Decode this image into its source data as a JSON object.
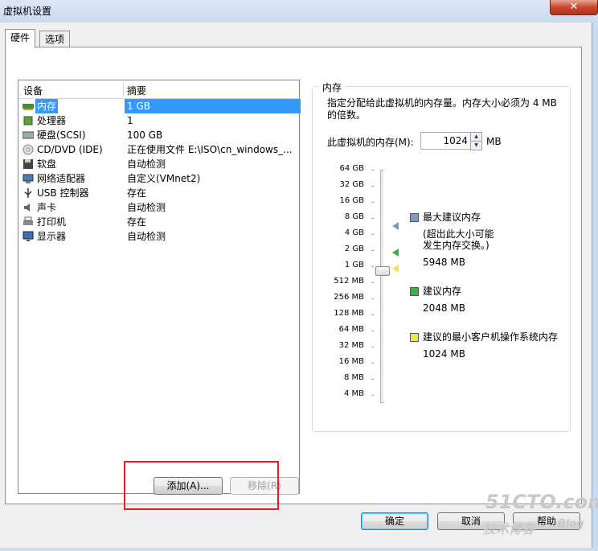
{
  "window": {
    "title": "虚拟机设置",
    "close_glyph": "✕"
  },
  "tabs": [
    {
      "label": "硬件"
    },
    {
      "label": "选项"
    }
  ],
  "device_list": {
    "col_device": "设备",
    "col_summary": "摘要",
    "rows": [
      {
        "name": "内存",
        "summary": "1 GB",
        "icon": "memory-icon",
        "selected": true
      },
      {
        "name": "处理器",
        "summary": "1",
        "icon": "processor-icon"
      },
      {
        "name": "硬盘(SCSI)",
        "summary": "100 GB",
        "icon": "hard-disk-icon"
      },
      {
        "name": "CD/DVD (IDE)",
        "summary": "正在使用文件 E:\\ISO\\cn_windows_...",
        "icon": "cd-dvd-icon"
      },
      {
        "name": "软盘",
        "summary": "自动检测",
        "icon": "floppy-icon"
      },
      {
        "name": "网络适配器",
        "summary": "自定义(VMnet2)",
        "icon": "network-adapter-icon"
      },
      {
        "name": "USB 控制器",
        "summary": "存在",
        "icon": "usb-icon"
      },
      {
        "name": "声卡",
        "summary": "自动检测",
        "icon": "sound-card-icon"
      },
      {
        "name": "打印机",
        "summary": "存在",
        "icon": "printer-icon"
      },
      {
        "name": "显示器",
        "summary": "自动检测",
        "icon": "display-icon"
      }
    ]
  },
  "buttons": {
    "add": "添加(A)...",
    "remove": "移除(R)",
    "ok": "确定",
    "cancel": "取消",
    "help": "帮助"
  },
  "memory": {
    "group_title": "内存",
    "description": "指定分配给此虚拟机的内存量。内存大小必须为 4 MB 的倍数。",
    "label": "此虚拟机的内存(M):",
    "value": "1024",
    "unit": "MB",
    "scale": [
      "64 GB",
      "32 GB",
      "16 GB",
      "8 GB",
      "4 GB",
      "2 GB",
      "1 GB",
      "512 MB",
      "256 MB",
      "128 MB",
      "64 MB",
      "32 MB",
      "16 MB",
      "8 MB",
      "4 MB"
    ],
    "legend": {
      "max_title": "最大建议内存",
      "max_note_1": "(超出此大小可能",
      "max_note_2": "发生内存交换。)",
      "max_value": "5948 MB",
      "rec_title": "建议内存",
      "rec_value": "2048 MB",
      "min_title": "建议的最小客户机操作系统内存",
      "min_value": "1024 MB"
    },
    "colors": {
      "max": "#7f9cc0",
      "rec": "#3cb043",
      "min": "#e8e84a"
    }
  },
  "watermark": {
    "logo": "51CTO.com",
    "line2": "技术博客",
    "blog": "Blog"
  }
}
